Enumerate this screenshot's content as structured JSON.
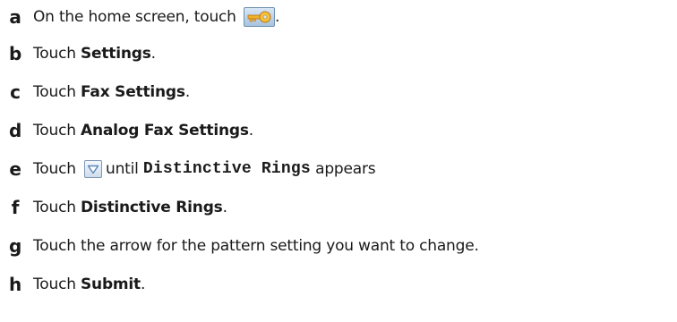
{
  "steps": [
    {
      "letter": "a",
      "text_before": "On the home screen, touch ",
      "icon": "key-icon",
      "text_after": "."
    },
    {
      "letter": "b",
      "text_before": "Touch ",
      "bold": "Settings",
      "text_after": "."
    },
    {
      "letter": "c",
      "text_before": "Touch ",
      "bold": "Fax Settings",
      "text_after": "."
    },
    {
      "letter": "d",
      "text_before": "Touch ",
      "bold": "Analog Fax Settings",
      "text_after": "."
    },
    {
      "letter": "e",
      "text_before": "Touch ",
      "icon": "down-arrow-icon",
      "text_middle": "until ",
      "mono": "Distinctive Rings",
      "text_after": " appears"
    },
    {
      "letter": "f",
      "text_before": "Touch ",
      "bold": "Distinctive Rings",
      "text_after": "."
    },
    {
      "letter": "g",
      "text_before": "Touch the arrow for the pattern setting you want to change."
    },
    {
      "letter": "h",
      "text_before": "Touch ",
      "bold": "Submit",
      "text_after": "."
    }
  ]
}
